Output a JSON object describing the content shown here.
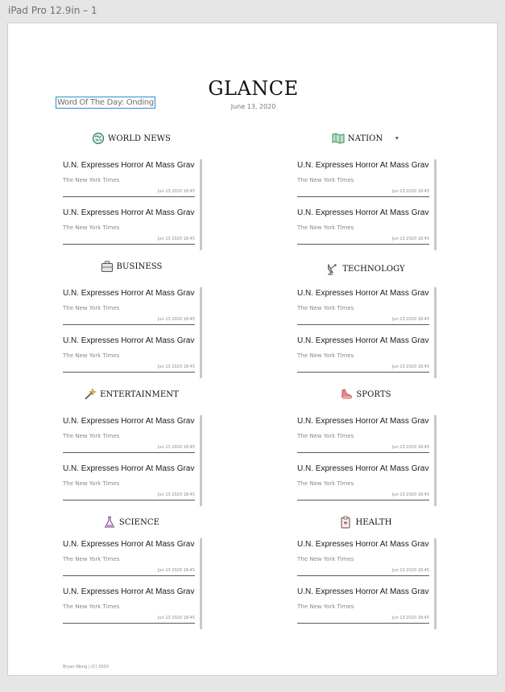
{
  "window": {
    "title": "iPad Pro 12.9in – 1"
  },
  "word_of_day": "Word Of The Day: Onding",
  "header": {
    "title": "GLANCE",
    "date": "June 13, 2020"
  },
  "sections": [
    {
      "key": "world",
      "title": "WORLD NEWS",
      "icon": "globe-icon",
      "articles": [
        {
          "title": "U.N. Expresses Horror At Mass Graves In",
          "source": "The New York Times",
          "time": "Jun 13 2020 18:45"
        },
        {
          "title": "U.N. Expresses Horror At Mass Graves In",
          "source": "The New York Times",
          "time": "Jun 13 2020 18:45"
        }
      ]
    },
    {
      "key": "nation",
      "title": "NATION",
      "icon": "map-icon",
      "caret": "▼",
      "articles": [
        {
          "title": "U.N. Expresses Horror At Mass Graves In",
          "source": "The New York Times",
          "time": "Jun 13 2020 18:45"
        },
        {
          "title": "U.N. Expresses Horror At Mass Graves In",
          "source": "The New York Times",
          "time": "Jun 13 2020 18:45"
        }
      ]
    },
    {
      "key": "business",
      "title": "BUSINESS",
      "icon": "briefcase-icon",
      "articles": [
        {
          "title": "U.N. Expresses Horror At Mass Graves In",
          "source": "The New York Times",
          "time": "Jun 13 2020 18:45"
        },
        {
          "title": "U.N. Expresses Horror At Mass Graves In",
          "source": "The New York Times",
          "time": "Jun 13 2020 18:45"
        }
      ]
    },
    {
      "key": "technology",
      "title": "TECHNOLOGY",
      "icon": "satellite-dish-icon",
      "articles": [
        {
          "title": "U.N. Expresses Horror At Mass Graves In",
          "source": "The New York Times",
          "time": "Jun 13 2020 18:45"
        },
        {
          "title": "U.N. Expresses Horror At Mass Graves In",
          "source": "The New York Times",
          "time": "Jun 13 2020 18:45"
        }
      ]
    },
    {
      "key": "entertainment",
      "title": "ENTERTAINMENT",
      "icon": "magic-wand-icon",
      "articles": [
        {
          "title": "U.N. Expresses Horror At Mass Graves In",
          "source": "The New York Times",
          "time": "Jun 13 2020 18:45"
        },
        {
          "title": "U.N. Expresses Horror At Mass Graves In",
          "source": "The New York Times",
          "time": "Jun 13 2020 18:45"
        }
      ]
    },
    {
      "key": "sports",
      "title": "SPORTS",
      "icon": "sneaker-icon",
      "articles": [
        {
          "title": "U.N. Expresses Horror At Mass Graves In",
          "source": "The New York Times",
          "time": "Jun 13 2020 18:45"
        },
        {
          "title": "U.N. Expresses Horror At Mass Graves In",
          "source": "The New York Times",
          "time": "Jun 13 2020 18:45"
        }
      ]
    },
    {
      "key": "science",
      "title": "SCIENCE",
      "icon": "flask-icon",
      "articles": [
        {
          "title": "U.N. Expresses Horror At Mass Graves In",
          "source": "The New York Times",
          "time": "Jun 13 2020 18:45"
        },
        {
          "title": "U.N. Expresses Horror At Mass Graves In",
          "source": "The New York Times",
          "time": "Jun 13 2020 18:45"
        }
      ]
    },
    {
      "key": "health",
      "title": "HEALTH",
      "icon": "medical-clipboard-icon",
      "articles": [
        {
          "title": "U.N. Expresses Horror At Mass Graves In",
          "source": "The New York Times",
          "time": "Jun 13 2020 18:45"
        },
        {
          "title": "U.N. Expresses Horror At Mass Graves In",
          "source": "The New York Times",
          "time": "Jun 13 2020 18:45"
        }
      ]
    }
  ],
  "footer": "Bryan Wong | (C) 2020",
  "colors": {
    "accent_border": "#2c8ec6",
    "rule": "#5a5a5a",
    "scrollbar": "#c8c8c8"
  }
}
